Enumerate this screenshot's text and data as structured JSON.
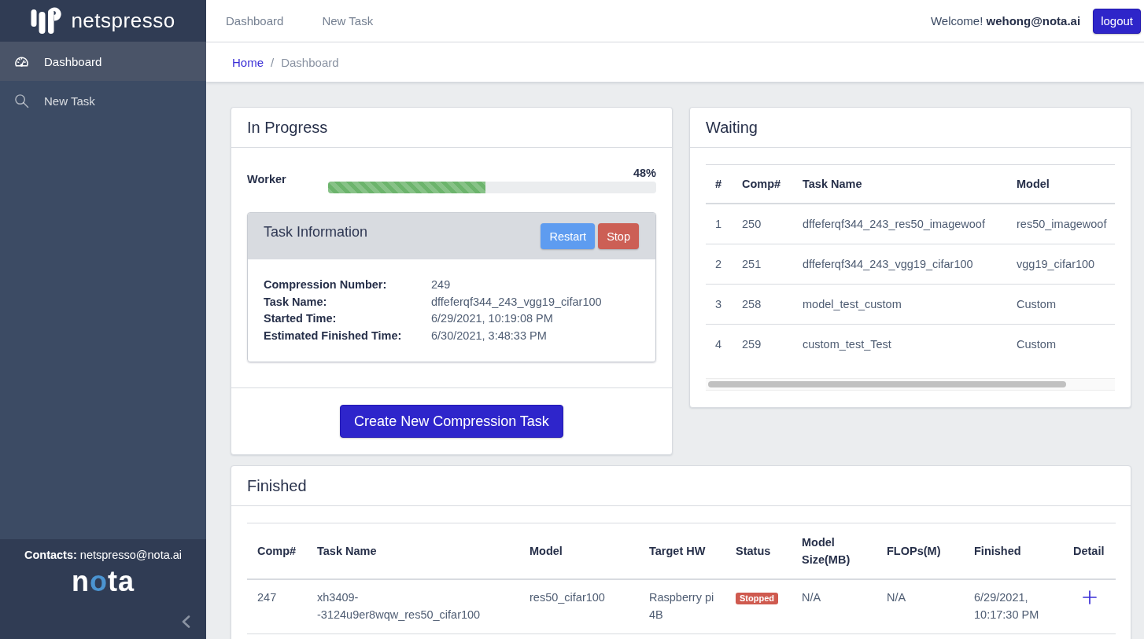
{
  "sidebar": {
    "brand": "netspresso",
    "items": [
      {
        "label": "Dashboard",
        "kind": "gauge",
        "selected": true
      },
      {
        "label": "New Task",
        "kind": "search",
        "selected": false
      }
    ],
    "contacts": "**Contacts:** netspresso@nota.ai",
    "footer_logo": "nota"
  },
  "topbar": {
    "nav": [
      "Dashboard",
      "New Task"
    ],
    "welcome": "Welcome! **wehong@nota.ai**",
    "logout": "logout"
  },
  "breadcrumb": {
    "items": [
      "Home",
      "Dashboard"
    ],
    "separator": "/"
  },
  "in_progress": {
    "title": "In Progress",
    "worker": {
      "label": "Worker",
      "level": 0.48,
      "reading": "48%"
    },
    "task_info": {
      "title": "Task Information",
      "buttons": [
        {
          "label": "Restart",
          "kind": "primary"
        },
        {
          "label": "Stop",
          "kind": "danger"
        }
      ],
      "fields": [
        {
          "label": "Compression Number:",
          "value": "249"
        },
        {
          "label": "Task Name:",
          "value": "dffeferqf344_243_vgg19_cifar100"
        },
        {
          "label": "Started Time:",
          "value": "6/29/2021, 10:19:08 PM"
        },
        {
          "label": "Estimated Finished Time:",
          "value": "6/30/2021, 3:48:33 PM"
        }
      ]
    },
    "create_button": "Create New Compression Task"
  },
  "waiting": {
    "title": "Waiting",
    "table": {
      "columns": [
        "#",
        "Comp#",
        "Task Name",
        "Model"
      ],
      "rows": [
        [
          "1",
          "250",
          "dffeferqf344_243_res50_imagewoof",
          "res50_imagewoof"
        ],
        [
          "2",
          "251",
          "dffeferqf344_243_vgg19_cifar100",
          "vgg19_cifar100"
        ],
        [
          "3",
          "258",
          "model_test_custom",
          "Custom"
        ],
        [
          "4",
          "259",
          "custom_test_Test",
          "Custom"
        ]
      ]
    }
  },
  "finished": {
    "title": "Finished",
    "table": {
      "columns": [
        "Comp#",
        "Task Name",
        "Model",
        "Target HW",
        "Status",
        "Model Size(MB)",
        "FLOPs(M)",
        "Finished",
        "Detail"
      ],
      "rows": [
        {
          "comp": "247",
          "task_name": "xh3409--3124u9er8wqw_res50_cifar100",
          "model": "res50_cifar100",
          "target_hw": "Raspberry pi 4B",
          "status": {
            "label": "Stopped",
            "color": "#cf5a4f"
          },
          "model_size": "N/A",
          "flops": "N/A",
          "finished": "6/29/2021, 10:17:30 PM"
        }
      ]
    }
  }
}
